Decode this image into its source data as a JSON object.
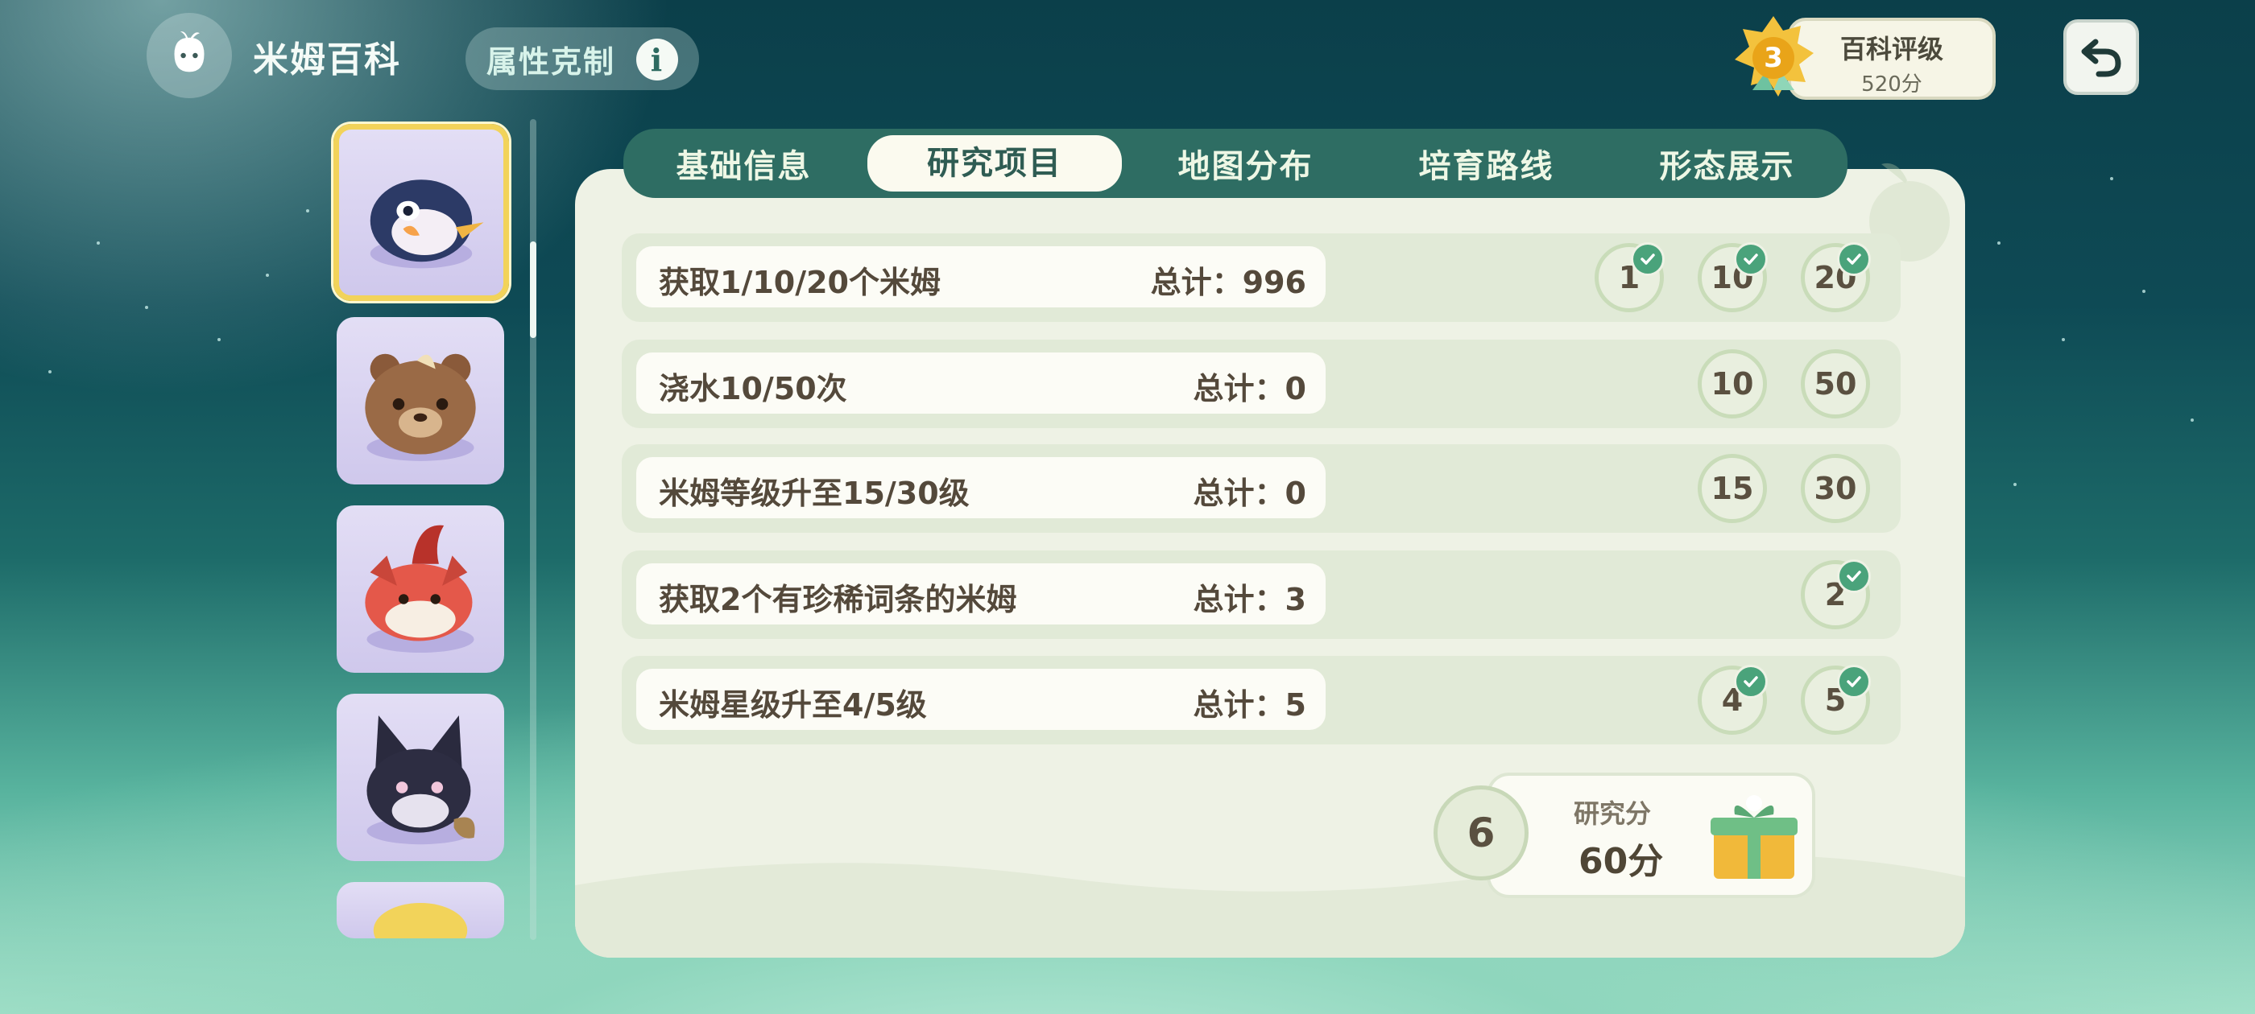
{
  "header": {
    "app_title": "米姆百科",
    "attr_button": "属性克制",
    "info_icon": "i",
    "rating": {
      "title": "百科评级",
      "score": "520分",
      "level": "3"
    }
  },
  "tabs": [
    "基础信息",
    "研究项目",
    "地图分布",
    "培育路线",
    "形态展示"
  ],
  "active_tab": 1,
  "research": [
    {
      "label": "获取1/10/20个米姆",
      "total": "总计：996",
      "milestones": [
        {
          "v": "1",
          "done": true
        },
        {
          "v": "10",
          "done": true
        },
        {
          "v": "20",
          "done": true
        }
      ]
    },
    {
      "label": "浇水10/50次",
      "total": "总计：0",
      "milestones": [
        {
          "v": "10",
          "done": false
        },
        {
          "v": "50",
          "done": false
        }
      ]
    },
    {
      "label": "米姆等级升至15/30级",
      "total": "总计：0",
      "milestones": [
        {
          "v": "15",
          "done": false
        },
        {
          "v": "30",
          "done": false
        }
      ]
    },
    {
      "label": "获取2个有珍稀词条的米姆",
      "total": "总计：3",
      "milestones": [
        {
          "v": "2",
          "done": true
        }
      ]
    },
    {
      "label": "米姆星级升至4/5级",
      "total": "总计：5",
      "milestones": [
        {
          "v": "4",
          "done": true
        },
        {
          "v": "5",
          "done": true
        }
      ]
    }
  ],
  "reward": {
    "count": "6",
    "label": "研究分",
    "value": "60分"
  },
  "colors": {
    "accent": "#2e6d63",
    "check": "#4aa37b",
    "selected_border": "#f2d35a"
  }
}
